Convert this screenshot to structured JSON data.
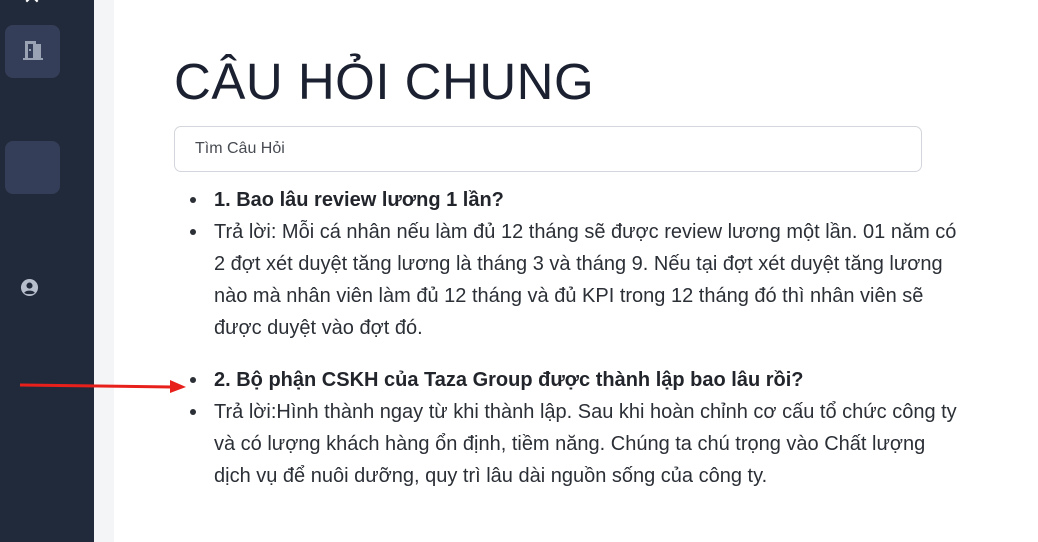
{
  "sidebar": {
    "items": [
      {
        "name": "door-icon"
      },
      {
        "name": "blank"
      },
      {
        "name": "user-circle-icon"
      }
    ]
  },
  "main": {
    "title": "CÂU HỎI CHUNG",
    "search": {
      "placeholder": "Tìm Câu Hỏi",
      "value": ""
    },
    "faqs": [
      {
        "question": "1. Bao lâu review lương 1 lần?",
        "answer": "Trả lời: Mỗi cá nhân nếu làm đủ 12 tháng sẽ được review lương một lần. 01 năm có 2 đợt xét duyệt tăng lương là tháng 3 và tháng 9. Nếu tại đợt xét duyệt tăng lương nào mà nhân viên làm đủ 12 tháng và đủ KPI trong 12 tháng đó thì nhân viên sẽ được duyệt vào đợt đó."
      },
      {
        "question": "2. Bộ phận CSKH của Taza Group được thành lập bao lâu rồi?",
        "answer": "Trả lời:Hình thành ngay từ khi thành lập. Sau khi hoàn chỉnh cơ cấu tổ chức công ty và có lượng khách hàng ổn định, tiềm năng. Chúng ta chú trọng vào Chất lượng dịch vụ để nuôi dưỡng, quy trì lâu dài nguồn sống của công ty."
      }
    ]
  },
  "colors": {
    "sidebar_bg": "#212a3a",
    "sidebar_button_bg": "#353e58",
    "annotation_arrow": "#e8201c"
  }
}
